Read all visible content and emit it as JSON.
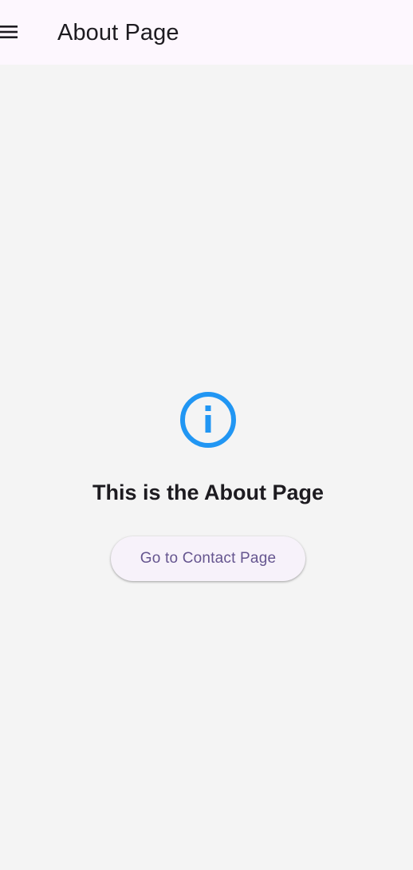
{
  "app_bar": {
    "menu_icon": "hamburger-menu-icon",
    "title": "About Page"
  },
  "main": {
    "icon": "info-icon",
    "heading": "This is the About Page",
    "button_label": "Go to Contact Page"
  },
  "colors": {
    "app_bar_bg": "#fdf7fe",
    "page_bg": "#f4f4f4",
    "icon": "#2196f3",
    "button_bg": "#f7f2fa",
    "button_text": "#65558f",
    "text": "#1d1b20"
  }
}
